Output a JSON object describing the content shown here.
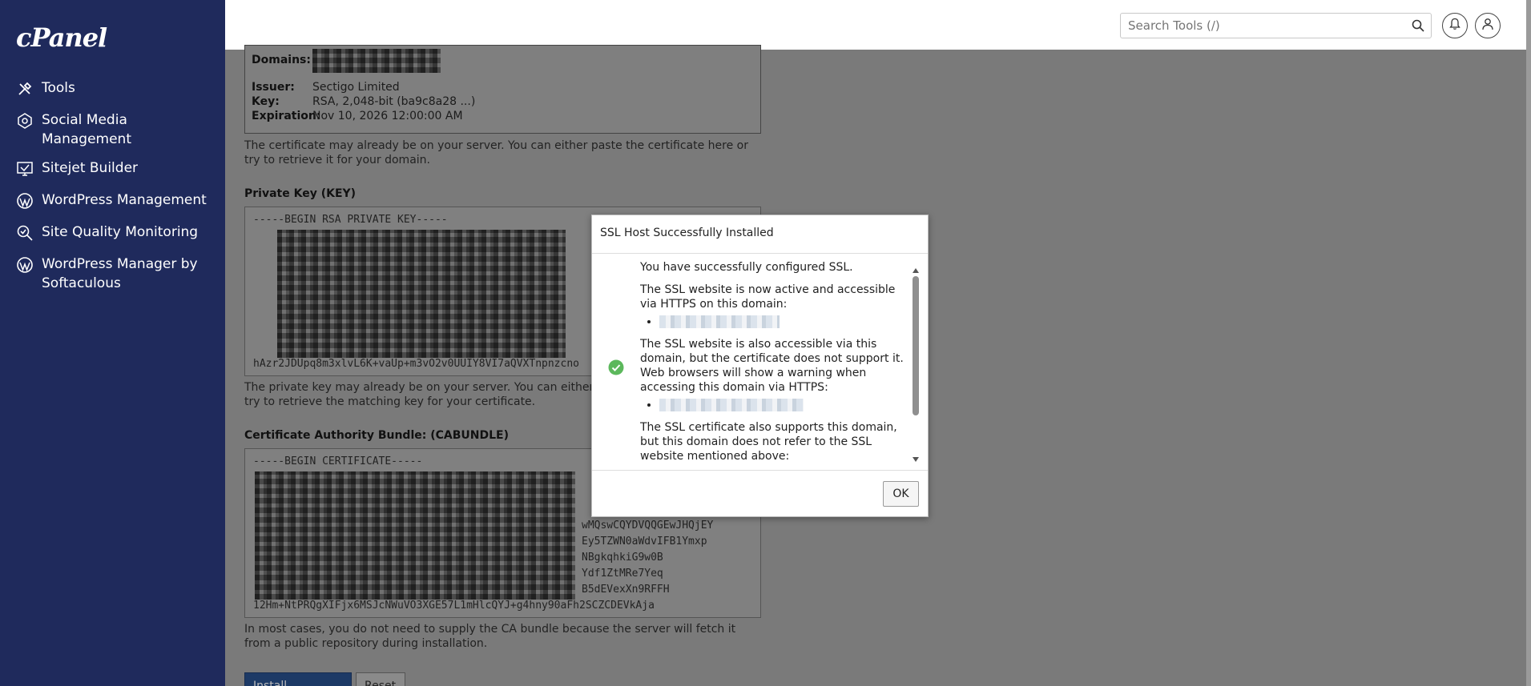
{
  "sidebar": {
    "logo": "cPanel",
    "items": [
      {
        "label": "Tools",
        "icon": "tools-icon"
      },
      {
        "label": "Social Media Management",
        "icon": "social-media-icon"
      },
      {
        "label": "Sitejet Builder",
        "icon": "sitejet-icon"
      },
      {
        "label": "WordPress Management",
        "icon": "wordpress-icon"
      },
      {
        "label": "Site Quality Monitoring",
        "icon": "site-quality-icon"
      },
      {
        "label": "WordPress Manager by Softaculous",
        "icon": "wordpress-icon"
      }
    ]
  },
  "header": {
    "search_placeholder": "Search Tools (/)"
  },
  "certificate": {
    "domains_label": "Domains:",
    "issuer_label": "Issuer:",
    "issuer": "Sectigo Limited",
    "key_label": "Key:",
    "key": "RSA, 2,048-bit (ba9c8a28 ...)",
    "expiration_label": "Expiration:",
    "expiration": "Nov 10, 2026 12:00:00 AM",
    "help": "The certificate may already be on your server. You can either paste the certificate here or try to retrieve it for your domain."
  },
  "private_key": {
    "label": "Private Key (KEY)",
    "first_line": "-----BEGIN RSA PRIVATE KEY-----",
    "visible_line": "hAzr2JDUpq8m3xlvL6K+vaUp+m3vO2v0UUIY8VI7aQVXTnpnzcno",
    "help": "The private key may already be on your server. You can either paste the private key here or try to retrieve the matching key for your certificate."
  },
  "ca_bundle": {
    "label": "Certificate Authority Bundle: (CABUNDLE)",
    "first_line": "-----BEGIN CERTIFICATE-----",
    "right_fragments": [
      "wMQswCQYDVQQGEwJHQjEY",
      "Ey5TZWN0aWdvIFB1Ymxp",
      "NBgkqhkiG9w0B",
      "Ydf1ZtMRe7Yeq",
      "B5dEVexXn9RFFH"
    ],
    "visible_line": "12Hm+NtPRQgXIFjx6MSJcNWuVO3XGE57L1mHlcQYJ+g4hny90aFh2SCZCDEVkAja",
    "help": "In most cases, you do not need to supply the CA bundle because the server will fetch it from a public repository during installation."
  },
  "buttons": {
    "install": "Install Certificate",
    "reset": "Reset"
  },
  "modal": {
    "title": "SSL Host Successfully Installed",
    "p1": "You have successfully configured SSL.",
    "p2": "The SSL website is now active and accessible via HTTPS on this domain:",
    "p3": "The SSL website is also accessible via this domain, but the certificate does not support it. Web browsers will show a warning when accessing this domain via HTTPS:",
    "p4": "The SSL certificate also supports this domain, but this domain does not refer to the SSL website mentioned above:",
    "ok": "OK"
  }
}
